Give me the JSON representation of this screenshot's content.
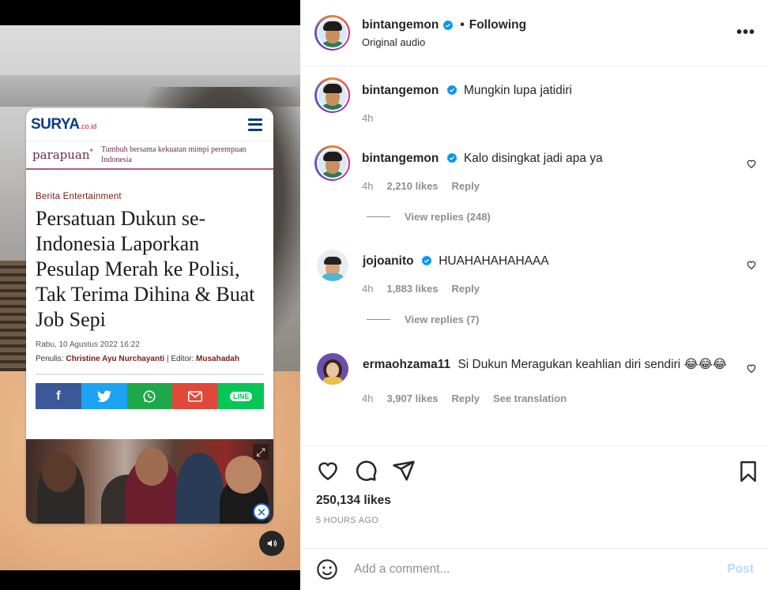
{
  "colors": {
    "accent": "#0095f6",
    "verified": "#0095f6",
    "muted": "#8e8e8e",
    "text": "#262626"
  },
  "media": {
    "article": {
      "site_logo": "SURYA",
      "site_logo_suffix": ".co.id",
      "partner_logo": "parapuan",
      "partner_tagline": "Tumbuh bersama kekuatan mimpi perempuan Indonesia",
      "category": "Berita Entertainment",
      "headline": "Persatuan Dukun se-Indonesia Laporkan Pesulap Merah ke Polisi, Tak Terima Dihina & Buat Job Sepi",
      "date": "Rabu, 10 Agustus 2022 16:22",
      "author_prefix": "Penulis: ",
      "author": "Christine Ayu Nurchayanti",
      "editor_prefix": " | Editor: ",
      "editor": "Musahadah",
      "share": [
        "f",
        "twitter-icon",
        "whatsapp-icon",
        "mail-icon",
        "LINE"
      ]
    },
    "mute_icon": "speaker-icon"
  },
  "header": {
    "username": "bintangemon",
    "separator": "•",
    "follow_status": "Following",
    "audio": "Original audio",
    "more_icon": "more-icon"
  },
  "comments": [
    {
      "username": "bintangemon",
      "text": "Mungkin lupa jatidiri",
      "time": "4h"
    },
    {
      "username": "bintangemon",
      "text": "Kalo disingkat jadi apa ya",
      "time": "4h",
      "likes": "2,210 likes",
      "reply": "Reply",
      "view_replies": "View replies (248)"
    },
    {
      "username": "jojoanito",
      "text": "HUAHAHAHAHAAA",
      "time": "4h",
      "likes": "1,883 likes",
      "reply": "Reply",
      "view_replies": "View replies (7)"
    },
    {
      "username": "ermaohzama11",
      "text": "Si Dukun Meragukan keahlian diri sendiri 😂😂😂",
      "time": "4h",
      "likes": "3,907 likes",
      "reply": "Reply",
      "translate": "See translation"
    }
  ],
  "actions": {
    "likes": "250,134 likes",
    "time_ago": "5 HOURS AGO"
  },
  "composer": {
    "placeholder": "Add a comment...",
    "post_label": "Post"
  }
}
